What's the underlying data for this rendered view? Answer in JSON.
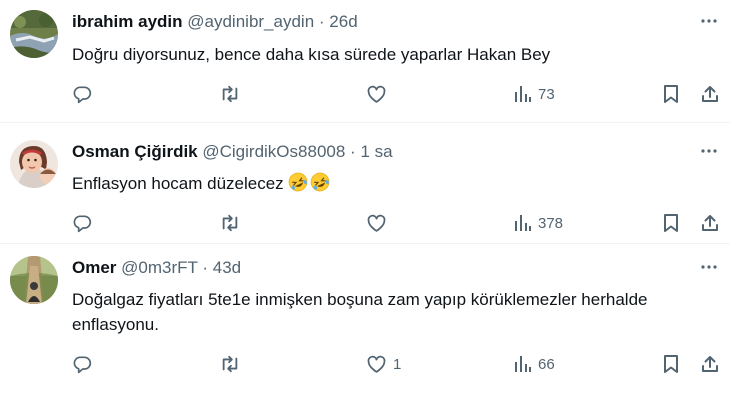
{
  "tweets": [
    {
      "name": "ibrahim aydin",
      "handle": "@aydinibr_aydin",
      "sep": "·",
      "time": "26d",
      "text": "Doğru diyorsunuz, bence daha kısa sürede yaparlar Hakan Bey",
      "views": "73",
      "likes": ""
    },
    {
      "name": "Osman Çiğirdik",
      "handle": "@CigirdikOs88008",
      "sep": "·",
      "time": "1 sa",
      "text": "Enflasyon hocam düzelecez",
      "emojis": [
        "rolling-on-floor-laughing-emoji",
        "rolling-on-floor-laughing-emoji"
      ],
      "views": "378",
      "likes": ""
    },
    {
      "name": "Omer",
      "handle": "@0m3rFT",
      "sep": "·",
      "time": "43d",
      "text": "Doğalgaz fiyatları 5te1e inmişken boşuna zam yapıp körüklemezler herhalde enflasyonu.",
      "views": "66",
      "likes": "1"
    }
  ],
  "icons": {
    "reply": "reply-icon",
    "retweet": "retweet-icon",
    "like": "like-icon",
    "views": "views-icon",
    "bookmark": "bookmark-icon",
    "share": "share-icon",
    "more": "more-icon"
  },
  "colors": {
    "text": "#0f1419",
    "secondary": "#536471",
    "divider": "#eff3f4"
  }
}
